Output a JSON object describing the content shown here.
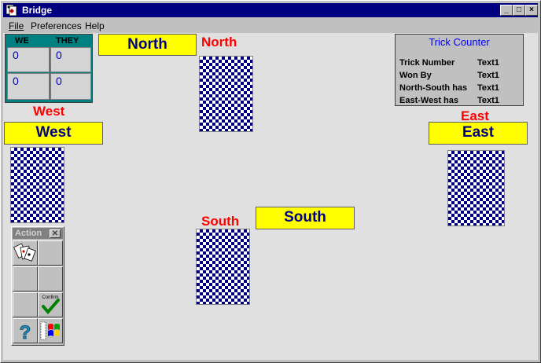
{
  "window": {
    "title": "Bridge"
  },
  "menu": {
    "file": "File",
    "preferences": "Preferences",
    "help": "Help"
  },
  "scoreboard": {
    "we_label": "WE",
    "they_label": "THEY",
    "rows": [
      {
        "we": "0",
        "they": "0"
      },
      {
        "we": "0",
        "they": "0"
      }
    ]
  },
  "seats": {
    "north": {
      "label": "North",
      "name": "North"
    },
    "south": {
      "label": "South",
      "name": "South"
    },
    "east": {
      "label": "East",
      "name": "East"
    },
    "west": {
      "label": "West",
      "name": "West"
    }
  },
  "trick_counter": {
    "title": "Trick Counter",
    "rows": [
      {
        "label": "Trick Number",
        "value": "Text1"
      },
      {
        "label": "Won By",
        "value": "Text1"
      },
      {
        "label": "North-South has",
        "value": "Text1"
      },
      {
        "label": "East-West has",
        "value": "Text1"
      }
    ]
  },
  "action_toolbar": {
    "title": "Action",
    "confirm_label": "Confirm",
    "icons": [
      "deal-cards-icon",
      "blank",
      "blank",
      "blank",
      "blank",
      "confirm-check-icon",
      "help-question-icon",
      "windows-flag-icon"
    ]
  },
  "colors": {
    "title_bar": "#000080",
    "name_box": "#ffff00",
    "name_text": "#000080",
    "seat_label": "#ff0000",
    "card_back": "#000080",
    "score_panel": "#008080"
  }
}
